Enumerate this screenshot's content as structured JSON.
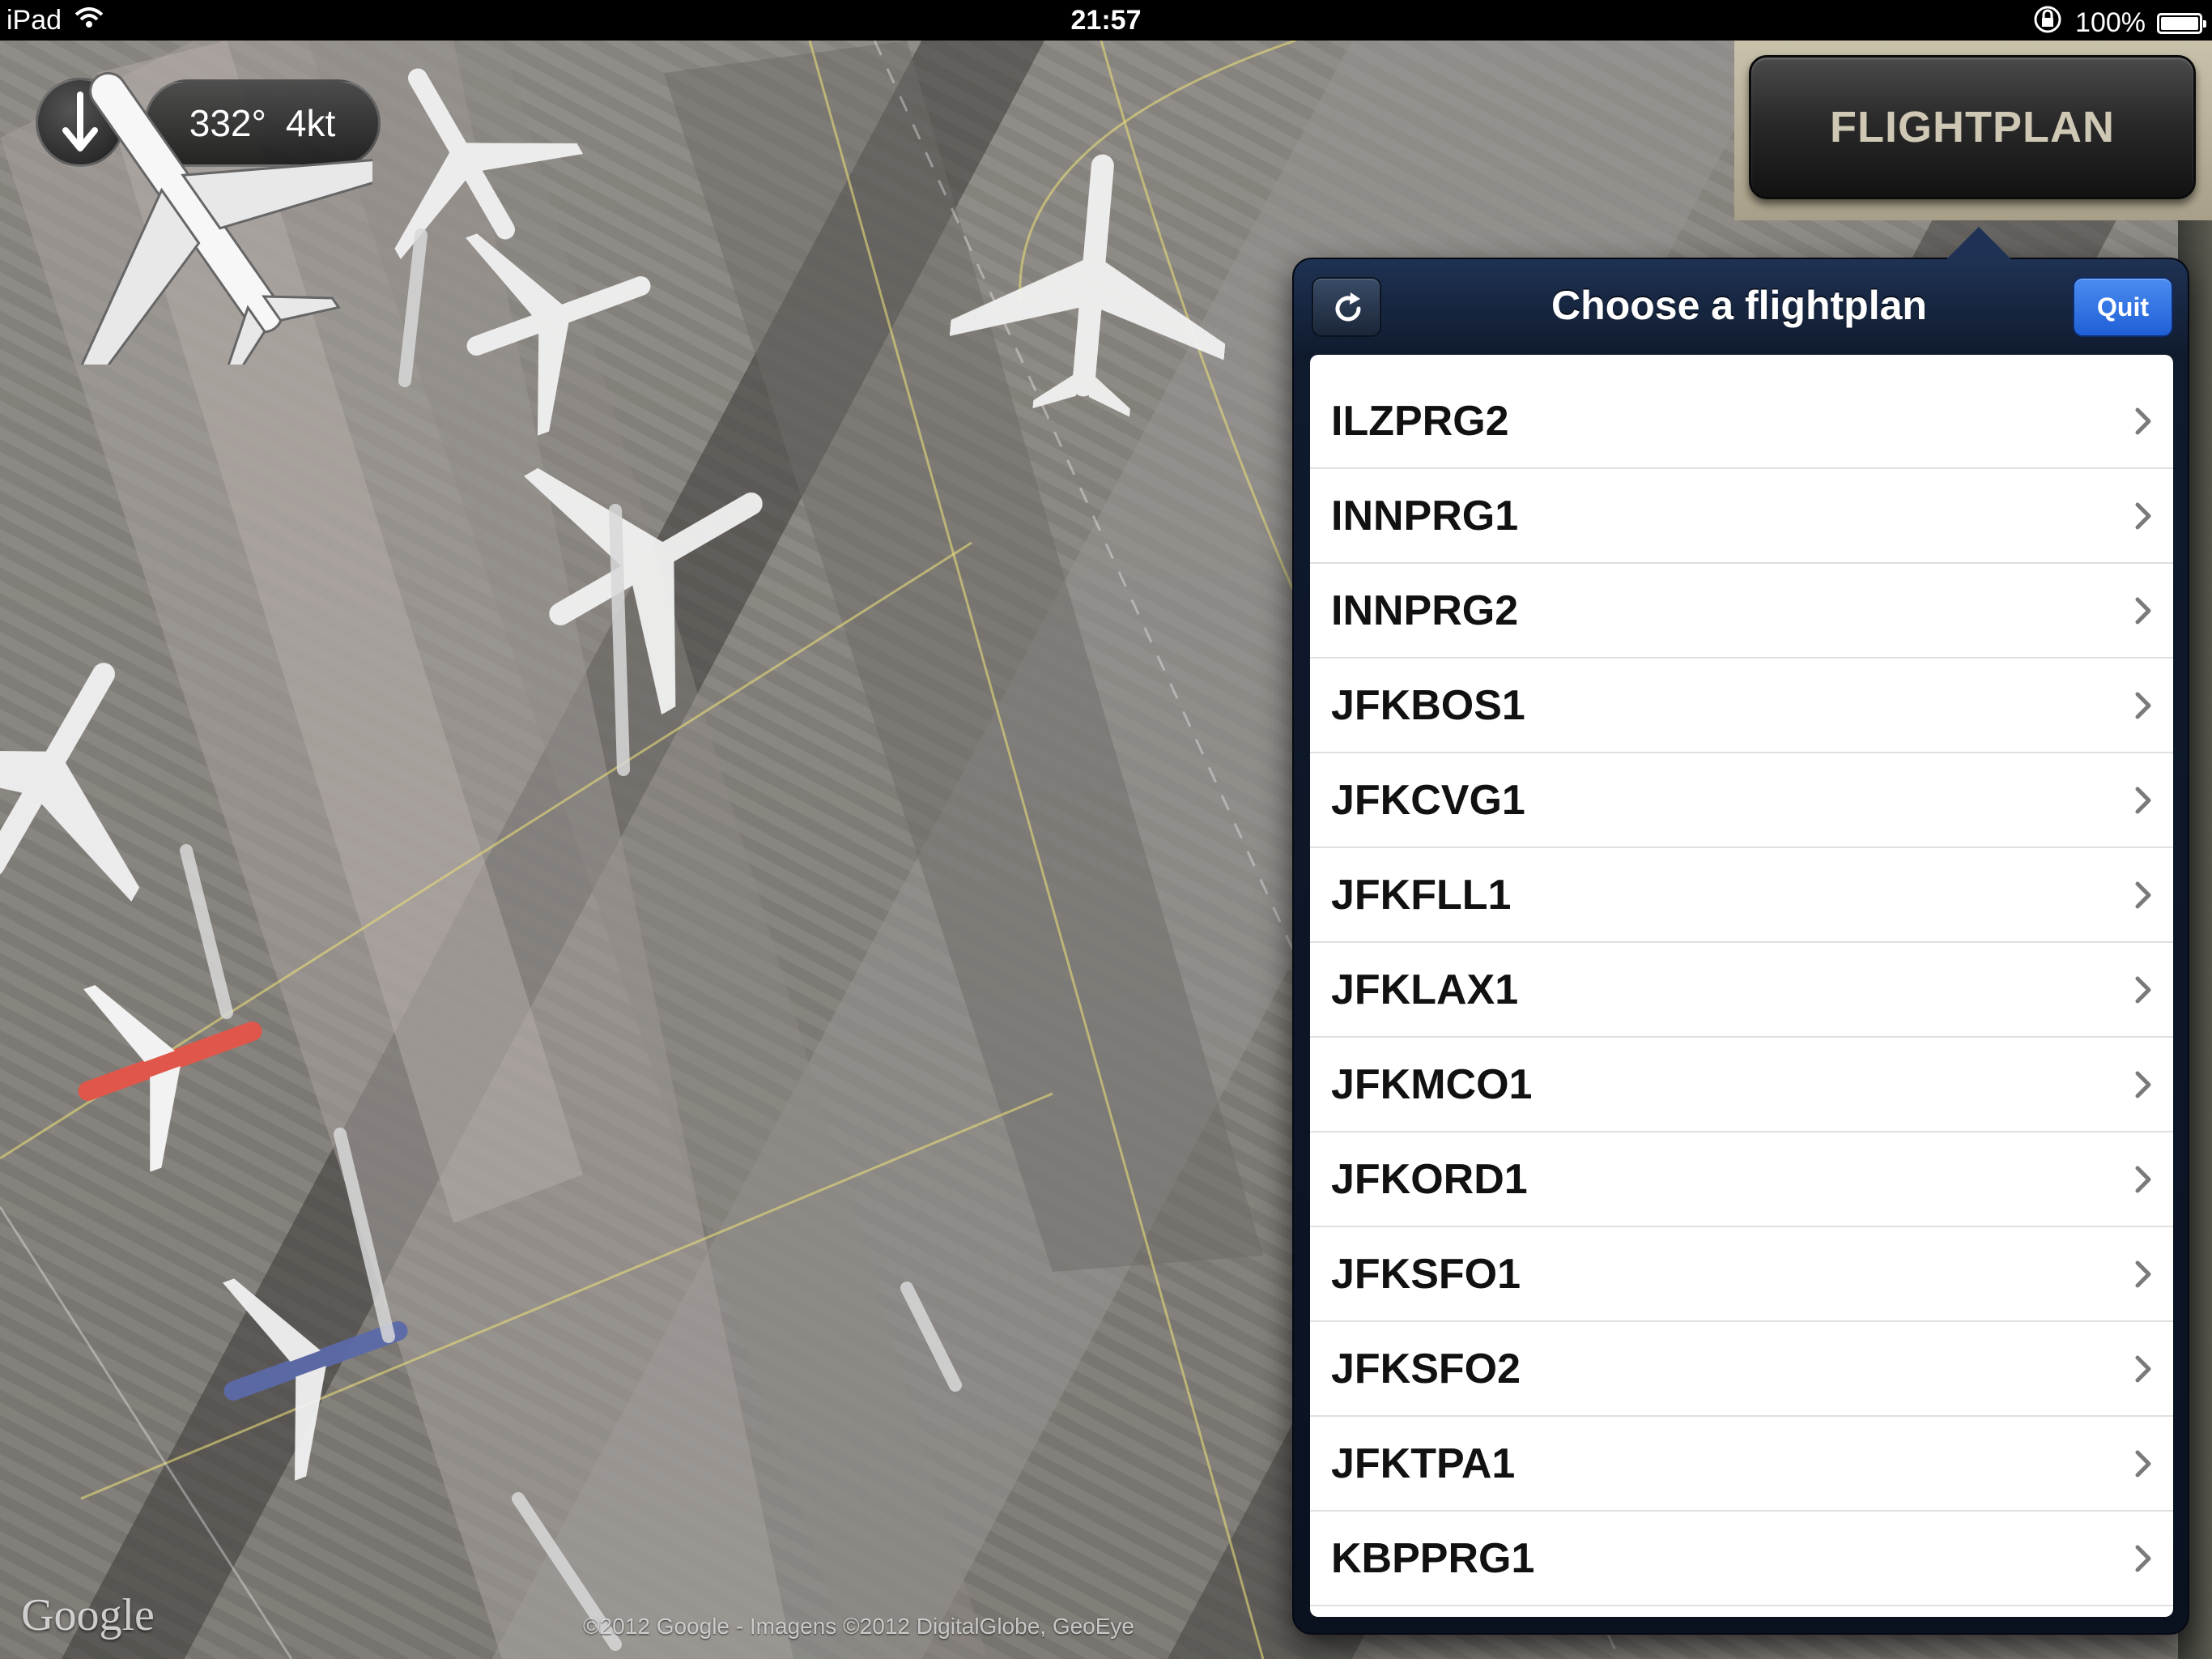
{
  "status_bar": {
    "device": "iPad",
    "time": "21:57",
    "battery": "100%"
  },
  "hud": {
    "heading": "332°",
    "speed": "4kt"
  },
  "map": {
    "logo": "Google",
    "attribution": "©2012 Google - Imagens ©2012 DigitalGlobe, GeoEye"
  },
  "flightplan_button": {
    "label": "FLIGHTPLAN"
  },
  "popover": {
    "title": "Choose a flightplan",
    "quit_label": "Quit",
    "items": [
      {
        "label": "ILZPRG2"
      },
      {
        "label": "INNPRG1"
      },
      {
        "label": "INNPRG2"
      },
      {
        "label": "JFKBOS1"
      },
      {
        "label": "JFKCVG1"
      },
      {
        "label": "JFKFLL1"
      },
      {
        "label": "JFKLAX1"
      },
      {
        "label": "JFKMCO1"
      },
      {
        "label": "JFKORD1"
      },
      {
        "label": "JFKSFO1"
      },
      {
        "label": "JFKSFO2"
      },
      {
        "label": "JFKTPA1"
      },
      {
        "label": "KBPPRG1"
      }
    ]
  },
  "icons": {
    "wifi": "wifi-icon",
    "lock": "rotation-lock-icon",
    "battery": "battery-icon",
    "compass": "heading-arrow-icon",
    "refresh": "refresh-icon",
    "chevron": "chevron-right-icon"
  },
  "colors": {
    "popover_header": "#1f3253",
    "quit_button": "#2f73e6",
    "flightplan_text": "#cfc8b4"
  }
}
